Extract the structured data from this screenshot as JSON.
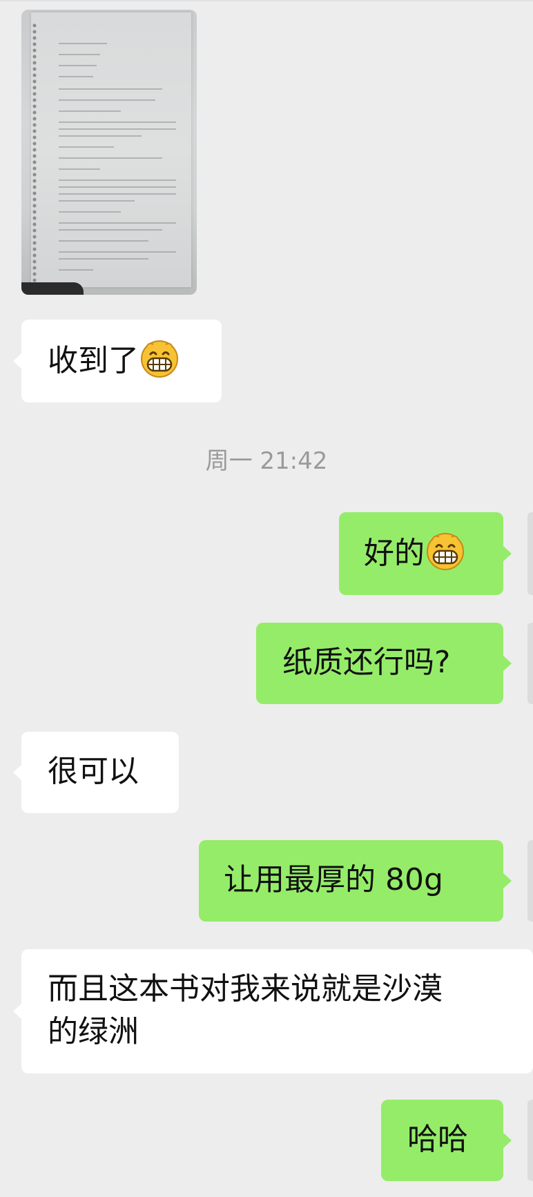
{
  "conversation": {
    "timestamp": "周一 21:42",
    "messages": [
      {
        "id": "m1",
        "side": "in",
        "type": "image",
        "alt": ""
      },
      {
        "id": "m2",
        "side": "in",
        "type": "text",
        "text": "收到了",
        "emoji": "grinning-face"
      },
      {
        "id": "m3",
        "side": "out",
        "type": "text",
        "text": "好的",
        "emoji": "grinning-face"
      },
      {
        "id": "m4",
        "side": "out",
        "type": "text",
        "text": "纸质还行吗?"
      },
      {
        "id": "m5",
        "side": "in",
        "type": "text",
        "text": "很可以"
      },
      {
        "id": "m6",
        "side": "out",
        "type": "text",
        "text": "让用最厚的 80g"
      },
      {
        "id": "m7",
        "side": "in",
        "type": "text",
        "text": "而且这本书对我来说就是沙漠\n的绿洲"
      },
      {
        "id": "m8",
        "side": "out",
        "type": "text",
        "text": "哈哈"
      }
    ]
  },
  "colors": {
    "background": "#ededed",
    "incoming_bubble": "#ffffff",
    "outgoing_bubble": "#95ec69",
    "timestamp_text": "#9a9a9a"
  }
}
